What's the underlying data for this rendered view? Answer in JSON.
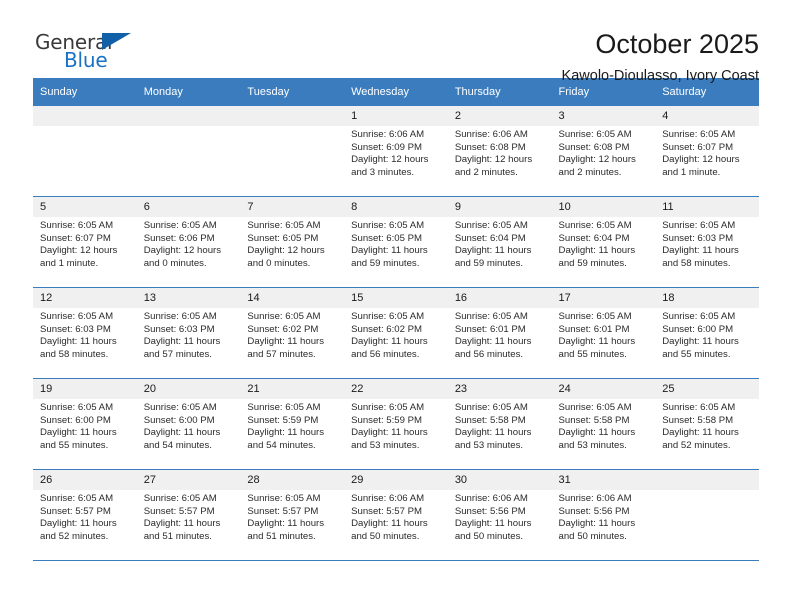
{
  "brand": {
    "name_top": "General",
    "name_bottom": "Blue",
    "accent_color": "#1b72c4",
    "triangle_color": "#1260a8"
  },
  "header": {
    "title": "October 2025",
    "subtitle": "Kawolo-Dioulasso, Ivory Coast",
    "header_bg": "#3a7cbe"
  },
  "calendar": {
    "weekdays": [
      "Sunday",
      "Monday",
      "Tuesday",
      "Wednesday",
      "Thursday",
      "Friday",
      "Saturday"
    ],
    "labels": {
      "sunrise": "Sunrise:",
      "sunset": "Sunset:",
      "daylight": "Daylight:"
    },
    "weeks": [
      [
        {
          "day": "",
          "sunrise": "",
          "sunset": "",
          "daylight": ""
        },
        {
          "day": "",
          "sunrise": "",
          "sunset": "",
          "daylight": ""
        },
        {
          "day": "",
          "sunrise": "",
          "sunset": "",
          "daylight": ""
        },
        {
          "day": "1",
          "sunrise": "Sunrise: 6:06 AM",
          "sunset": "Sunset: 6:09 PM",
          "daylight": "Daylight: 12 hours and 3 minutes."
        },
        {
          "day": "2",
          "sunrise": "Sunrise: 6:06 AM",
          "sunset": "Sunset: 6:08 PM",
          "daylight": "Daylight: 12 hours and 2 minutes."
        },
        {
          "day": "3",
          "sunrise": "Sunrise: 6:05 AM",
          "sunset": "Sunset: 6:08 PM",
          "daylight": "Daylight: 12 hours and 2 minutes."
        },
        {
          "day": "4",
          "sunrise": "Sunrise: 6:05 AM",
          "sunset": "Sunset: 6:07 PM",
          "daylight": "Daylight: 12 hours and 1 minute."
        }
      ],
      [
        {
          "day": "5",
          "sunrise": "Sunrise: 6:05 AM",
          "sunset": "Sunset: 6:07 PM",
          "daylight": "Daylight: 12 hours and 1 minute."
        },
        {
          "day": "6",
          "sunrise": "Sunrise: 6:05 AM",
          "sunset": "Sunset: 6:06 PM",
          "daylight": "Daylight: 12 hours and 0 minutes."
        },
        {
          "day": "7",
          "sunrise": "Sunrise: 6:05 AM",
          "sunset": "Sunset: 6:05 PM",
          "daylight": "Daylight: 12 hours and 0 minutes."
        },
        {
          "day": "8",
          "sunrise": "Sunrise: 6:05 AM",
          "sunset": "Sunset: 6:05 PM",
          "daylight": "Daylight: 11 hours and 59 minutes."
        },
        {
          "day": "9",
          "sunrise": "Sunrise: 6:05 AM",
          "sunset": "Sunset: 6:04 PM",
          "daylight": "Daylight: 11 hours and 59 minutes."
        },
        {
          "day": "10",
          "sunrise": "Sunrise: 6:05 AM",
          "sunset": "Sunset: 6:04 PM",
          "daylight": "Daylight: 11 hours and 59 minutes."
        },
        {
          "day": "11",
          "sunrise": "Sunrise: 6:05 AM",
          "sunset": "Sunset: 6:03 PM",
          "daylight": "Daylight: 11 hours and 58 minutes."
        }
      ],
      [
        {
          "day": "12",
          "sunrise": "Sunrise: 6:05 AM",
          "sunset": "Sunset: 6:03 PM",
          "daylight": "Daylight: 11 hours and 58 minutes."
        },
        {
          "day": "13",
          "sunrise": "Sunrise: 6:05 AM",
          "sunset": "Sunset: 6:03 PM",
          "daylight": "Daylight: 11 hours and 57 minutes."
        },
        {
          "day": "14",
          "sunrise": "Sunrise: 6:05 AM",
          "sunset": "Sunset: 6:02 PM",
          "daylight": "Daylight: 11 hours and 57 minutes."
        },
        {
          "day": "15",
          "sunrise": "Sunrise: 6:05 AM",
          "sunset": "Sunset: 6:02 PM",
          "daylight": "Daylight: 11 hours and 56 minutes."
        },
        {
          "day": "16",
          "sunrise": "Sunrise: 6:05 AM",
          "sunset": "Sunset: 6:01 PM",
          "daylight": "Daylight: 11 hours and 56 minutes."
        },
        {
          "day": "17",
          "sunrise": "Sunrise: 6:05 AM",
          "sunset": "Sunset: 6:01 PM",
          "daylight": "Daylight: 11 hours and 55 minutes."
        },
        {
          "day": "18",
          "sunrise": "Sunrise: 6:05 AM",
          "sunset": "Sunset: 6:00 PM",
          "daylight": "Daylight: 11 hours and 55 minutes."
        }
      ],
      [
        {
          "day": "19",
          "sunrise": "Sunrise: 6:05 AM",
          "sunset": "Sunset: 6:00 PM",
          "daylight": "Daylight: 11 hours and 55 minutes."
        },
        {
          "day": "20",
          "sunrise": "Sunrise: 6:05 AM",
          "sunset": "Sunset: 6:00 PM",
          "daylight": "Daylight: 11 hours and 54 minutes."
        },
        {
          "day": "21",
          "sunrise": "Sunrise: 6:05 AM",
          "sunset": "Sunset: 5:59 PM",
          "daylight": "Daylight: 11 hours and 54 minutes."
        },
        {
          "day": "22",
          "sunrise": "Sunrise: 6:05 AM",
          "sunset": "Sunset: 5:59 PM",
          "daylight": "Daylight: 11 hours and 53 minutes."
        },
        {
          "day": "23",
          "sunrise": "Sunrise: 6:05 AM",
          "sunset": "Sunset: 5:58 PM",
          "daylight": "Daylight: 11 hours and 53 minutes."
        },
        {
          "day": "24",
          "sunrise": "Sunrise: 6:05 AM",
          "sunset": "Sunset: 5:58 PM",
          "daylight": "Daylight: 11 hours and 53 minutes."
        },
        {
          "day": "25",
          "sunrise": "Sunrise: 6:05 AM",
          "sunset": "Sunset: 5:58 PM",
          "daylight": "Daylight: 11 hours and 52 minutes."
        }
      ],
      [
        {
          "day": "26",
          "sunrise": "Sunrise: 6:05 AM",
          "sunset": "Sunset: 5:57 PM",
          "daylight": "Daylight: 11 hours and 52 minutes."
        },
        {
          "day": "27",
          "sunrise": "Sunrise: 6:05 AM",
          "sunset": "Sunset: 5:57 PM",
          "daylight": "Daylight: 11 hours and 51 minutes."
        },
        {
          "day": "28",
          "sunrise": "Sunrise: 6:05 AM",
          "sunset": "Sunset: 5:57 PM",
          "daylight": "Daylight: 11 hours and 51 minutes."
        },
        {
          "day": "29",
          "sunrise": "Sunrise: 6:06 AM",
          "sunset": "Sunset: 5:57 PM",
          "daylight": "Daylight: 11 hours and 50 minutes."
        },
        {
          "day": "30",
          "sunrise": "Sunrise: 6:06 AM",
          "sunset": "Sunset: 5:56 PM",
          "daylight": "Daylight: 11 hours and 50 minutes."
        },
        {
          "day": "31",
          "sunrise": "Sunrise: 6:06 AM",
          "sunset": "Sunset: 5:56 PM",
          "daylight": "Daylight: 11 hours and 50 minutes."
        },
        {
          "day": "",
          "sunrise": "",
          "sunset": "",
          "daylight": ""
        }
      ]
    ]
  }
}
